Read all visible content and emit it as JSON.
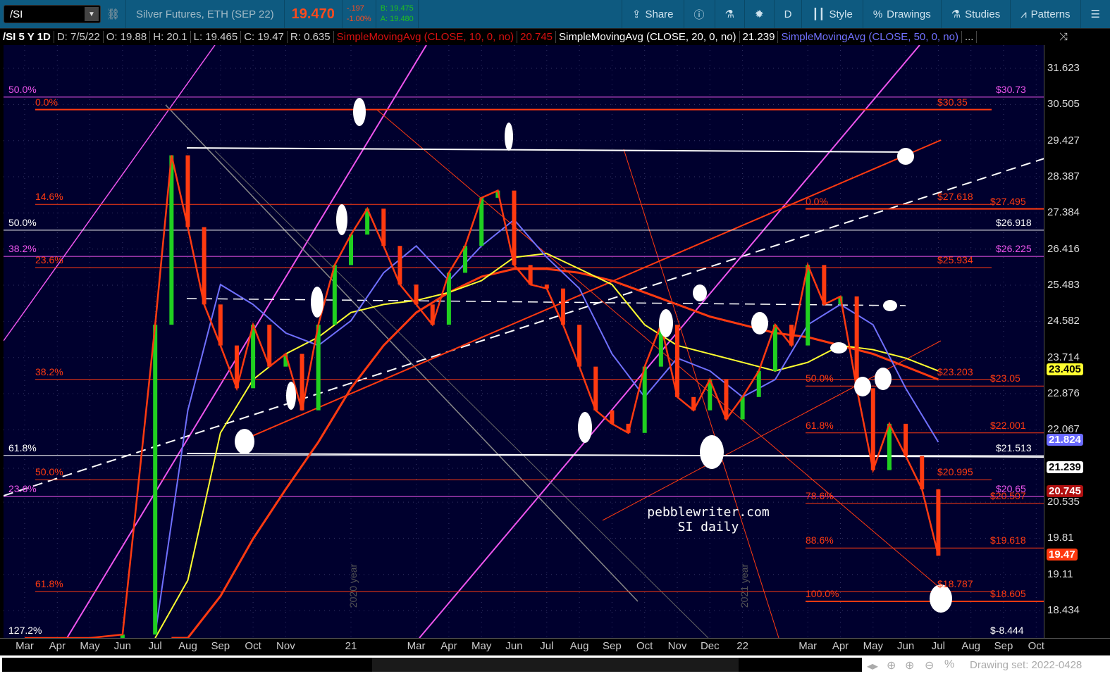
{
  "toolbar": {
    "symbol": "/SI",
    "description": "Silver Futures, ETH (SEP 22)",
    "last": "19.470",
    "change": "-.197",
    "change_pct": "-1.00%",
    "bid": "B: 19.475",
    "ask": "A: 19.480",
    "share": "Share",
    "timeframe": "D",
    "style": "Style",
    "drawings": "Drawings",
    "studies": "Studies",
    "patterns": "Patterns"
  },
  "info": {
    "title": "/SI 5 Y 1D",
    "date": "D: 7/5/22",
    "open": "O: 19.88",
    "high": "H: 20.1",
    "low": "L: 19.465",
    "close": "C: 19.47",
    "range": "R: 0.635",
    "sma10": "SimpleMovingAvg (CLOSE, 10, 0, no)",
    "sma10_val": "20.745",
    "sma20": "SimpleMovingAvg (CLOSE, 20, 0, no)",
    "sma20_val": "21.239",
    "sma50": "SimpleMovingAvg (CLOSE, 50, 0, no)",
    "more": "..."
  },
  "watermark": {
    "line1": "pebblewriter.com",
    "line2": "SI daily",
    "year2020": "2020 year",
    "year2021": "2021 year"
  },
  "bottom": {
    "drawing_set": "Drawing set: 2022-0428"
  },
  "colors": {
    "red": "#ff3a10",
    "magenta": "#ee55ee",
    "white": "#ffffff",
    "yellow": "#ffff30",
    "blue": "#7070ff",
    "bg": "#00002e"
  },
  "chart_data": {
    "type": "line",
    "title": "/SI 5 Y 1D",
    "xlabel": "",
    "ylabel": "",
    "scale": "log",
    "ylim": [
      18.2,
      32.5
    ],
    "y_ticks": [
      "31.623",
      "30.505",
      "29.427",
      "28.387",
      "27.384",
      "26.416",
      "25.483",
      "24.582",
      "23.714",
      "22.876",
      "22.067",
      "21.239",
      "20.535",
      "19.81",
      "19.11",
      "18.434"
    ],
    "x_ticks": [
      "Mar",
      "Apr",
      "May",
      "Jun",
      "Jul",
      "Aug",
      "Sep",
      "Oct",
      "Nov",
      "21",
      "Mar",
      "Apr",
      "May",
      "Jun",
      "Jul",
      "Aug",
      "Sep",
      "Oct",
      "Nov",
      "Dec",
      "22",
      "Mar",
      "Apr",
      "May",
      "Jun",
      "Jul",
      "Aug",
      "Sep",
      "Oct"
    ],
    "x_tick_months": [
      0,
      1,
      2,
      3,
      4,
      5,
      6,
      7,
      8,
      10,
      12,
      13,
      14,
      15,
      16,
      17,
      18,
      19,
      20,
      21,
      22,
      24,
      25,
      26,
      27,
      28,
      29,
      30,
      31
    ],
    "price": {
      "months": [
        0,
        1,
        2,
        3,
        4,
        4.5,
        5,
        5.5,
        6,
        6.5,
        7,
        7.5,
        8,
        8.5,
        9,
        9.5,
        10,
        10.5,
        11,
        11.5,
        12,
        12.5,
        13,
        13.5,
        14,
        14.5,
        15,
        15.5,
        16,
        16.5,
        17,
        17.5,
        18,
        18.5,
        19,
        19.5,
        20,
        20.5,
        21,
        21.5,
        22,
        22.5,
        23,
        23.5,
        24,
        24.5,
        25,
        25.5,
        26,
        26.5,
        27,
        27.5,
        28
      ],
      "values": [
        14,
        15,
        17.5,
        18,
        24.5,
        29,
        27,
        25,
        24,
        23,
        24.5,
        23.5,
        23.8,
        22.5,
        24.5,
        26,
        26.8,
        27.5,
        26.5,
        25.5,
        25,
        24.5,
        25.8,
        26.5,
        27.8,
        28,
        26,
        25.5,
        25.4,
        24.5,
        23.5,
        22.5,
        22.2,
        22,
        23.5,
        24.5,
        22.8,
        22.5,
        23.2,
        22.3,
        22.8,
        23.4,
        24.5,
        24,
        26,
        25,
        25.2,
        23,
        21.2,
        22.2,
        21.5,
        20.8,
        19.47
      ]
    },
    "sma_ma50": {
      "months": [
        4,
        5,
        6,
        7,
        8,
        9,
        10,
        11,
        12,
        13,
        14,
        15,
        16,
        17,
        18,
        19,
        20,
        21,
        22,
        23,
        24,
        25,
        26,
        27,
        28
      ],
      "values": [
        18,
        22.5,
        25.5,
        25,
        24.3,
        24,
        24.6,
        25.8,
        26.5,
        25.6,
        26.5,
        27.2,
        26.2,
        25.4,
        23.8,
        22.8,
        23.7,
        23.4,
        22.8,
        23.2,
        24.5,
        25,
        24.5,
        23,
        21.8
      ]
    },
    "sma_ma100": {
      "months": [
        4,
        5,
        6,
        7,
        8,
        9,
        10,
        11,
        12,
        13,
        14,
        15,
        16,
        17,
        18,
        19,
        20,
        21,
        22,
        23,
        24,
        25,
        26,
        27,
        28
      ],
      "values": [
        16.5,
        19,
        22,
        23.2,
        23.8,
        24.2,
        24.8,
        25,
        25.1,
        25.3,
        25.6,
        26.2,
        26.3,
        25.9,
        25.5,
        24.5,
        24,
        23.8,
        23.6,
        23.4,
        23.6,
        24,
        23.9,
        23.7,
        23.4
      ]
    },
    "sma_ma200": {
      "months": [
        4.5,
        5,
        6,
        7,
        8,
        9,
        10,
        11,
        12,
        13,
        14,
        15,
        16,
        17,
        18,
        19,
        20,
        21,
        22,
        23,
        24,
        25,
        26,
        27,
        28
      ],
      "values": [
        16,
        17,
        18.7,
        19.8,
        20.8,
        21.8,
        23,
        24,
        24.8,
        25.3,
        25.7,
        25.9,
        25.9,
        25.8,
        25.6,
        25.3,
        25,
        24.7,
        24.5,
        24.3,
        24.2,
        24,
        23.8,
        23.5,
        23.2
      ]
    },
    "levels": [
      {
        "price": 30.73,
        "label": "$30.73",
        "left": "50.0%",
        "color": "magenta"
      },
      {
        "price": 30.35,
        "label": "$30.35",
        "left": "0.0%",
        "color": "red"
      },
      {
        "price": 27.618,
        "label": "$27.618",
        "left": "14.6%",
        "color": "red"
      },
      {
        "price": 27.495,
        "label": "$27.495",
        "left": "0.0%",
        "color": "red"
      },
      {
        "price": 26.918,
        "label": "$26.918",
        "left": "50.0%",
        "color": "white"
      },
      {
        "price": 26.225,
        "label": "$26.225",
        "left": "38.2%",
        "color": "magenta"
      },
      {
        "price": 25.934,
        "label": "$25.934",
        "left": "23.6%",
        "color": "red"
      },
      {
        "price": 23.203,
        "label": "$23.203",
        "left": "38.2%",
        "color": "red"
      },
      {
        "price": 23.05,
        "label": "$23.05",
        "left": "50.0%",
        "color": "red"
      },
      {
        "price": 22.001,
        "label": "$22.001",
        "left": "61.8%",
        "color": "red"
      },
      {
        "price": 21.513,
        "label": "$21.513",
        "left": "61.8%",
        "color": "white"
      },
      {
        "price": 20.995,
        "label": "$20.995",
        "left": "50.0%",
        "color": "red"
      },
      {
        "price": 20.65,
        "label": "$20.65",
        "left": "23.6%",
        "color": "magenta"
      },
      {
        "price": 20.507,
        "label": "$20.507",
        "left": "78.6%",
        "color": "red"
      },
      {
        "price": 19.618,
        "label": "$19.618",
        "left": "88.6%",
        "color": "red"
      },
      {
        "price": 18.787,
        "label": "$18.787",
        "left": "61.8%",
        "color": "red"
      },
      {
        "price": 18.605,
        "label": "$18.605",
        "left": "100.0%",
        "color": "red"
      }
    ],
    "bottom_labels": {
      "left": "127.2%",
      "right": "$-8.444"
    },
    "badges": [
      {
        "value": "23.405",
        "kind": "yellow"
      },
      {
        "value": "21.824",
        "kind": "blue"
      },
      {
        "value": "21.239",
        "kind": "white"
      },
      {
        "value": "20.745",
        "kind": "darkred"
      },
      {
        "value": "19.47",
        "kind": "red"
      }
    ]
  }
}
